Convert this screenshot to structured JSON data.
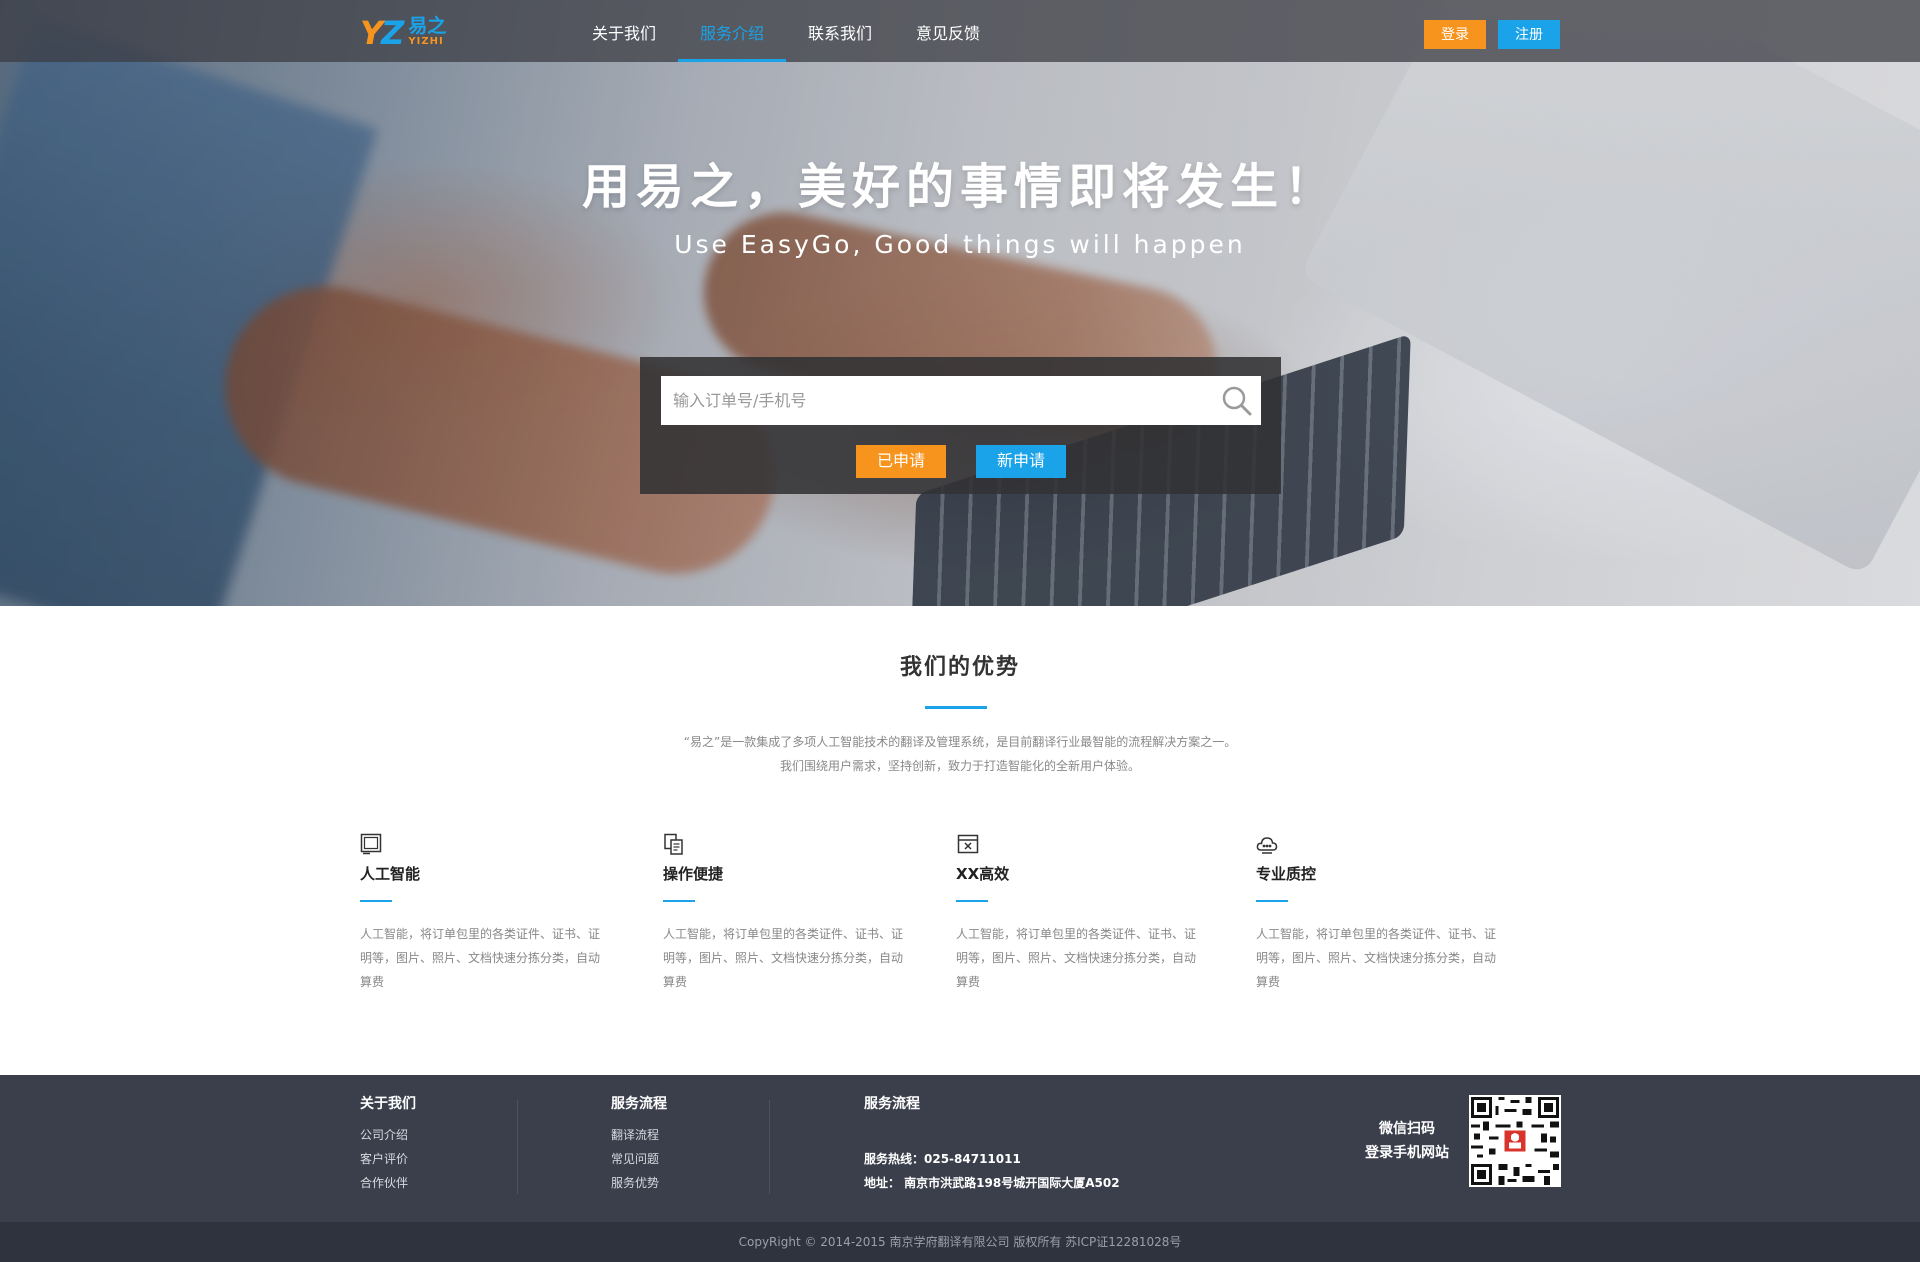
{
  "nav": {
    "logo_mark_a": "Y",
    "logo_mark_b": "Z",
    "logo_cn": "易之",
    "logo_en": "YIZHI",
    "menu": [
      {
        "label": "关于我们",
        "active": false
      },
      {
        "label": "服务介绍",
        "active": true
      },
      {
        "label": "联系我们",
        "active": false
      },
      {
        "label": "意见反馈",
        "active": false
      }
    ],
    "login_label": "登录",
    "register_label": "注册"
  },
  "hero": {
    "title": "用易之，美好的事情即将发生！",
    "subtitle": "Use EasyGo, Good things will happen",
    "search_placeholder": "输入订单号/手机号",
    "search_value": "",
    "applied_label": "已申请",
    "new_label": "新申请"
  },
  "advantages": {
    "title": "我们的优势",
    "desc_line1": "“易之”是一款集成了多项人工智能技术的翻译及管理系统，是目前翻译行业最智能的流程解决方案之一。",
    "desc_line2": "我们围绕用户需求，坚持创新，致力于打造智能化的全新用户体验。",
    "features": [
      {
        "icon": "tablet-icon",
        "title": "人工智能",
        "desc": "人工智能，将订单包里的各类证件、证书、证明等，图片、照片、文档快速分拣分类，自动算费"
      },
      {
        "icon": "document-copy-icon",
        "title": "操作便捷",
        "desc": "人工智能，将订单包里的各类证件、证书、证明等，图片、照片、文档快速分拣分类，自动算费"
      },
      {
        "icon": "window-close-icon",
        "title": "XX高效",
        "desc": "人工智能，将订单包里的各类证件、证书、证明等，图片、照片、文档快速分拣分类，自动算费"
      },
      {
        "icon": "cloud-icon",
        "title": "专业质控",
        "desc": "人工智能，将订单包里的各类证件、证书、证明等，图片、照片、文档快速分拣分类，自动算费"
      }
    ]
  },
  "footer": {
    "col1": {
      "title": "关于我们",
      "links": [
        "公司介绍",
        "客户评价",
        "合作伙伴"
      ]
    },
    "col2": {
      "title": "服务流程",
      "links": [
        "翻译流程",
        "常见问题",
        "服务优势"
      ]
    },
    "col3": {
      "title": "服务流程",
      "hotline": "服务热线：025-84711011",
      "address": "地址： 南京市洪武路198号城开国际大厦A502"
    },
    "qr_line1": "微信扫码",
    "qr_line2": "登录手机网站",
    "copyright": "CopyRight © 2014-2015 南京学府翻译有限公司 版权所有 苏ICP证12281028号"
  },
  "colors": {
    "accent_blue": "#1aa3e8",
    "accent_orange": "#f7941d",
    "footer_bg": "#3a3f4b",
    "copyright_bg": "#2f333d"
  }
}
